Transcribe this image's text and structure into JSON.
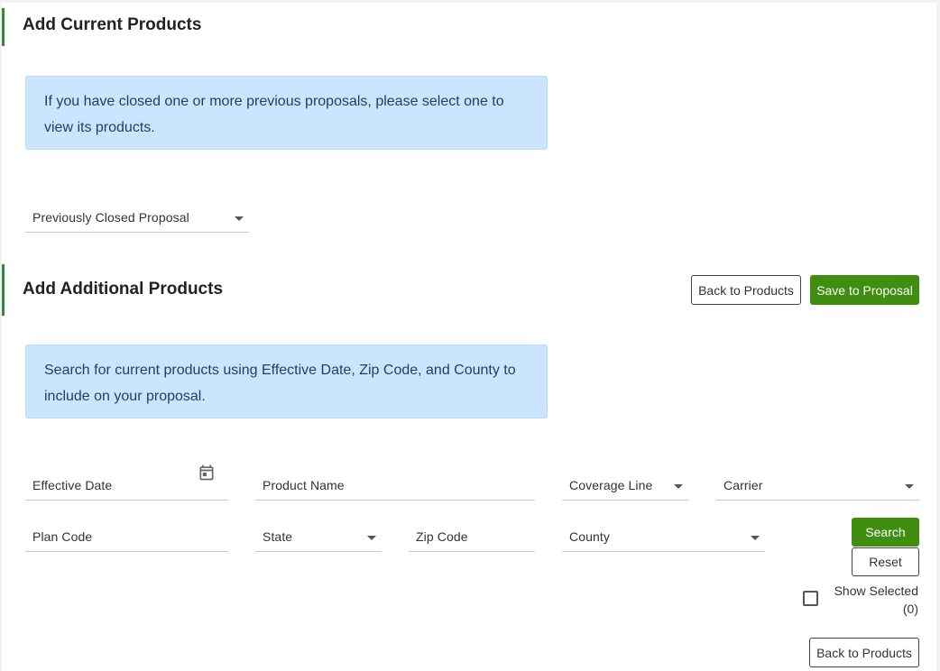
{
  "current_section": {
    "title": "Add Current Products",
    "info_text": "If you have closed one or more previous proposals, please select one to view its products.",
    "proposal_select_label": "Previously Closed Proposal"
  },
  "additional_section": {
    "title": "Add Additional Products",
    "back_button_label": "Back to Products",
    "save_button_label": "Save to Proposal",
    "info_text": "Search for current products using Effective Date, Zip Code, and County to include on your proposal."
  },
  "filters": {
    "effective_date": "Effective Date",
    "product_name": "Product Name",
    "coverage_line": "Coverage Line",
    "carrier": "Carrier",
    "plan_code": "Plan Code",
    "state": "State",
    "zip_code": "Zip Code",
    "county": "County"
  },
  "actions": {
    "search_label": "Search",
    "reset_label": "Reset",
    "show_selected_label": "Show Selected",
    "show_selected_count": "(0)",
    "bottom_back_label": "Back to Products"
  },
  "colors": {
    "accent_green": "#3f8e10",
    "section_bar": "#2e8b3e",
    "info_bg": "#cce5ff"
  }
}
